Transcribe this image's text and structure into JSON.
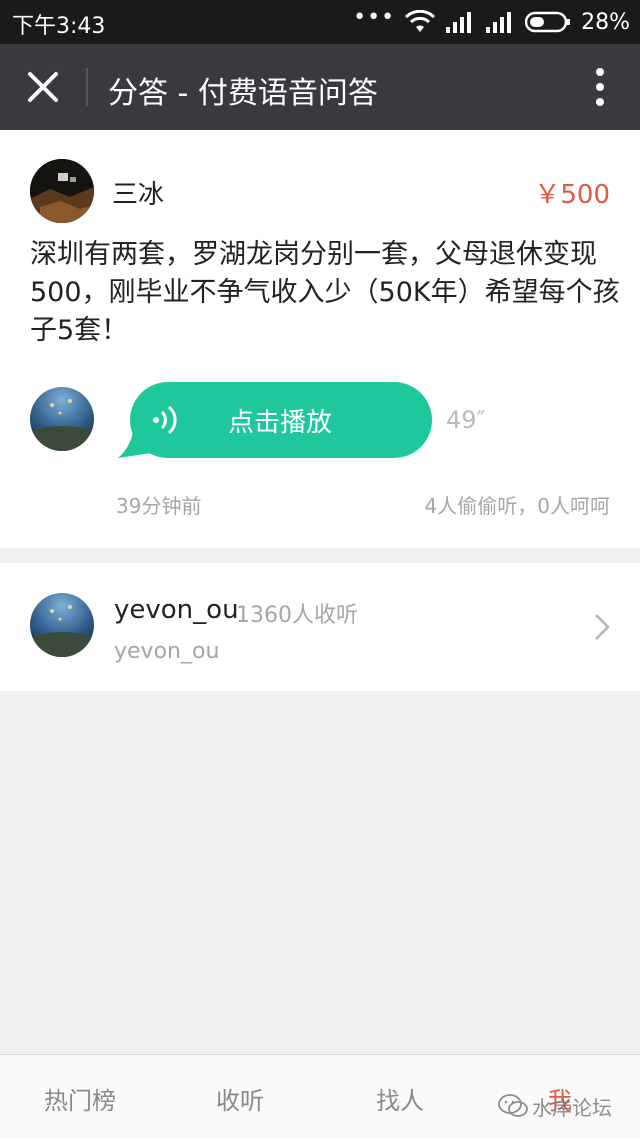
{
  "status_bar": {
    "time": "下午3:43",
    "more": "•••",
    "battery": "28%"
  },
  "title_bar": {
    "title": "分答 - 付费语音问答"
  },
  "question": {
    "asker_name": "三冰",
    "price": "￥500",
    "text": "深圳有两套，罗湖龙岗分别一套，父母退休变现500，刚毕业不争气收入少（50K年）希望每个孩子5套！",
    "play_label": "点击播放",
    "duration": "49″",
    "time_ago": "39分钟前",
    "listen_stats": "4人偷偷听，0人呵呵"
  },
  "answerer": {
    "name": "yevon_ou",
    "listeners": "1360人收听",
    "subtitle": "yevon_ou"
  },
  "bottom_nav": {
    "items": [
      {
        "label": "热门榜"
      },
      {
        "label": "收听"
      },
      {
        "label": "找人"
      },
      {
        "label": "我"
      }
    ]
  },
  "watermark": {
    "text": "水岸论坛"
  },
  "colors": {
    "accent_green": "#1fc89c",
    "price_red": "#e05b40",
    "title_bar_bg": "#393a3f"
  }
}
